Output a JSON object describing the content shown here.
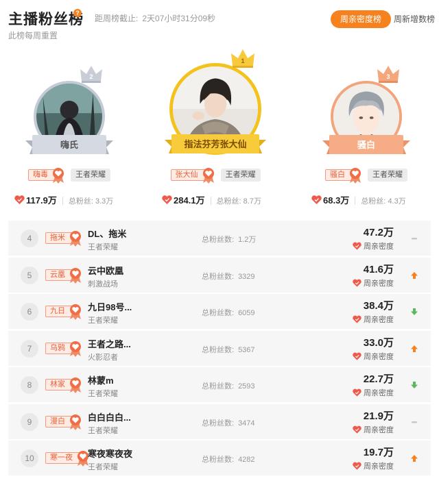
{
  "header": {
    "title": "主播粉丝榜",
    "help_icon": "?",
    "countdown_label": "距周榜截止:",
    "countdown_value": "2天07小时31分09秒",
    "subtitle": "此榜每周重置",
    "tabs": [
      {
        "label": "周亲密度榜",
        "active": true
      },
      {
        "label": "周新增数榜",
        "active": false
      }
    ]
  },
  "colors": {
    "accent": "#f5821f",
    "gold": "#f4c21d",
    "silver": "#c5cbd6",
    "bronze": "#f2a57d",
    "badge_text": "#e8623b",
    "up": "#f5821f",
    "down": "#5cb85c",
    "flat": "#c8c8c8"
  },
  "podium": [
    {
      "rank": "2",
      "name": "嗨氏",
      "badge": "嗨毒",
      "game": "王者荣耀",
      "intimacy": "117.9万",
      "fans_label": "总粉丝:",
      "fans": "3.3万",
      "crown": "silver-crown-icon"
    },
    {
      "rank": "1",
      "name": "指法芬芳张大仙",
      "badge": "张大仙",
      "game": "王者荣耀",
      "intimacy": "284.1万",
      "fans_label": "总粉丝:",
      "fans": "8.7万",
      "crown": "gold-crown-icon"
    },
    {
      "rank": "3",
      "name": "骚白",
      "badge": "骚白",
      "game": "王者荣耀",
      "intimacy": "68.3万",
      "fans_label": "总粉丝:",
      "fans": "4.3万",
      "crown": "bronze-crown-icon"
    }
  ],
  "list": [
    {
      "rank": "4",
      "badge": "拖米",
      "name": "DL、拖米",
      "game": "王者荣耀",
      "fans_label": "总粉丝数:",
      "fans": "1.2万",
      "score": "47.2万",
      "score_label": "周亲密度",
      "trend": "flat"
    },
    {
      "rank": "5",
      "badge": "云凰",
      "name": "云中欧凰",
      "game": "刺激战场",
      "fans_label": "总粉丝数:",
      "fans": "3329",
      "score": "41.6万",
      "score_label": "周亲密度",
      "trend": "up"
    },
    {
      "rank": "6",
      "badge": "九日",
      "name": "九日98号...",
      "game": "王者荣耀",
      "fans_label": "总粉丝数:",
      "fans": "6059",
      "score": "38.4万",
      "score_label": "周亲密度",
      "trend": "down"
    },
    {
      "rank": "7",
      "badge": "乌鸦",
      "name": "王者之路...",
      "game": "火影忍者",
      "fans_label": "总粉丝数:",
      "fans": "5367",
      "score": "33.0万",
      "score_label": "周亲密度",
      "trend": "up"
    },
    {
      "rank": "8",
      "badge": "林家",
      "name": "林蒙m",
      "game": "王者荣耀",
      "fans_label": "总粉丝数:",
      "fans": "2593",
      "score": "22.7万",
      "score_label": "周亲密度",
      "trend": "down"
    },
    {
      "rank": "9",
      "badge": "漫白",
      "name": "白白白白...",
      "game": "王者荣耀",
      "fans_label": "总粉丝数:",
      "fans": "3474",
      "score": "21.9万",
      "score_label": "周亲密度",
      "trend": "flat"
    },
    {
      "rank": "10",
      "badge": "寒一夜",
      "name": "寒夜寒夜夜",
      "game": "王者荣耀",
      "fans_label": "总粉丝数:",
      "fans": "4282",
      "score": "19.7万",
      "score_label": "周亲密度",
      "trend": "up"
    }
  ]
}
